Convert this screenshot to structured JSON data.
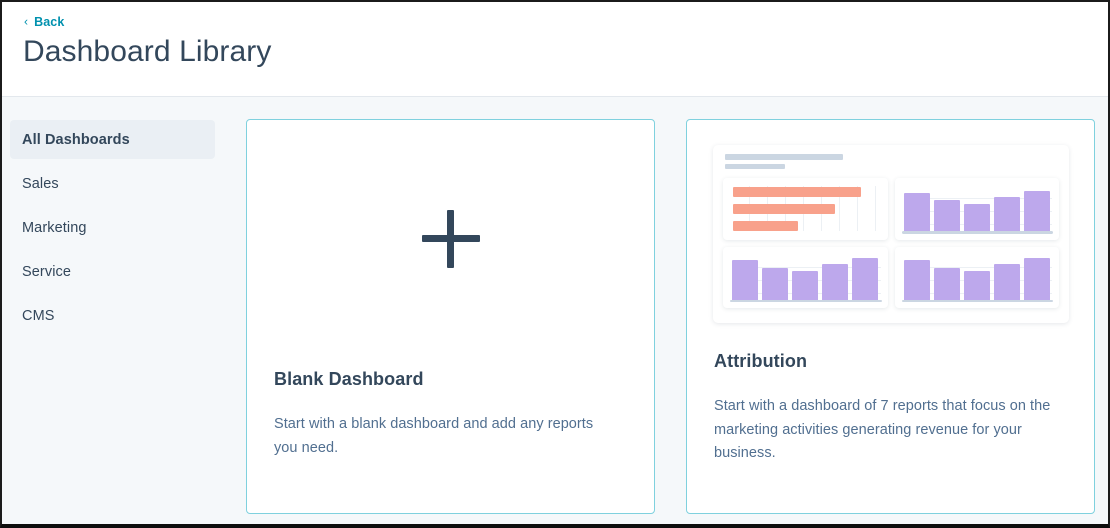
{
  "header": {
    "back_label": "Back",
    "back_icon": "chevron-left-icon",
    "title": "Dashboard Library"
  },
  "sidebar": {
    "items": [
      {
        "label": "All Dashboards",
        "active": true
      },
      {
        "label": "Sales",
        "active": false
      },
      {
        "label": "Marketing",
        "active": false
      },
      {
        "label": "Service",
        "active": false
      },
      {
        "label": "CMS",
        "active": false
      }
    ]
  },
  "cards": [
    {
      "id": "blank-dashboard",
      "title": "Blank Dashboard",
      "description": "Start with a blank dashboard and add any reports you need.",
      "icon": "plus-icon"
    },
    {
      "id": "attribution",
      "title": "Attribution",
      "description": "Start with a dashboard of 7 reports that focus on the marketing activities generating revenue for your business.",
      "preview": {
        "headline_placeholder": "",
        "subline_placeholder": "",
        "panels": [
          {
            "type": "horizontal-bar",
            "values": [
              88,
              70,
              45
            ],
            "color": "#f8a18b"
          },
          {
            "type": "vertical-bar",
            "values": [
              86,
              70,
              62,
              77,
              90
            ],
            "color": "#bda8ec"
          },
          {
            "type": "vertical-bar",
            "values": [
              88,
              72,
              64,
              80,
              92
            ],
            "color": "#bda8ec"
          },
          {
            "type": "vertical-bar",
            "values": [
              88,
              72,
              64,
              80,
              92
            ],
            "color": "#bda8ec"
          }
        ]
      }
    }
  ],
  "colors": {
    "accent_link": "#0091ae",
    "card_border": "#7fd1de",
    "text_primary": "#33475b",
    "text_secondary": "#516f90",
    "page_background": "#f5f8fa",
    "sidebar_active": "#eaeff4",
    "bar_coral": "#f8a18b",
    "bar_purple": "#bda8ec",
    "placeholder_grey": "#cbd6e2"
  }
}
